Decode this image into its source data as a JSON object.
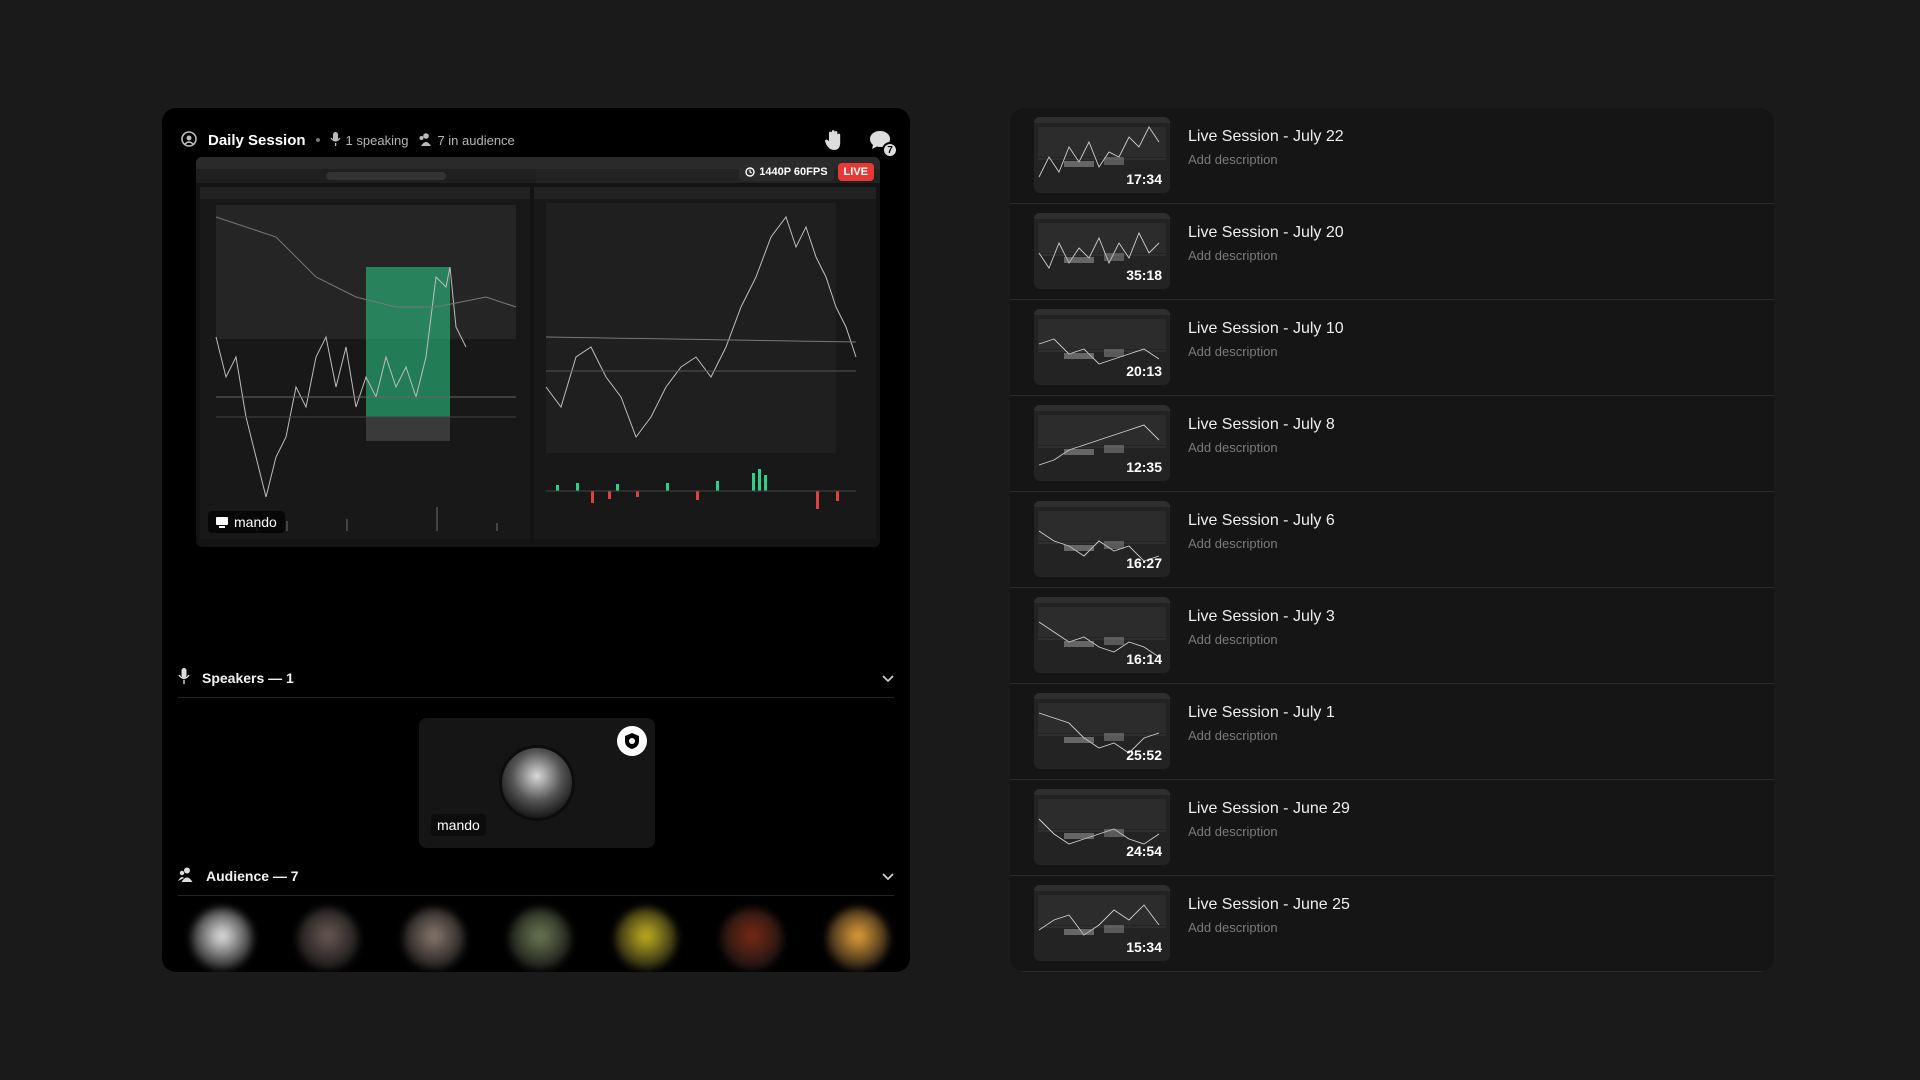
{
  "stage": {
    "title": "Daily Session",
    "speaking": "1 speaking",
    "audience_count": "7 in audience",
    "notification_count": "7",
    "stream": {
      "quality": "1440P 60FPS",
      "live": "LIVE",
      "user": "mando"
    },
    "speakers_label": "Speakers — 1",
    "speaker": {
      "name": "mando"
    },
    "audience_label": "Audience — 7",
    "audience": [
      {
        "color": "#e8e8e8"
      },
      {
        "color": "#6b5a55"
      },
      {
        "color": "#8a7a70"
      },
      {
        "color": "#6e7a55"
      },
      {
        "color": "#c6b420"
      },
      {
        "color": "#7a2a15"
      },
      {
        "color": "#e8a23a"
      }
    ],
    "colors": {
      "accent_red": "#e0383e",
      "live_red": "#e53935",
      "screen_green": "#2bd08a"
    }
  },
  "sessions": [
    {
      "title": "Live Session - July 22",
      "description": "Add description",
      "duration": "17:34"
    },
    {
      "title": "Live Session - July 20",
      "description": "Add description",
      "duration": "35:18"
    },
    {
      "title": "Live Session - July 10",
      "description": "Add description",
      "duration": "20:13"
    },
    {
      "title": "Live Session - July 8",
      "description": "Add description",
      "duration": "12:35"
    },
    {
      "title": "Live Session - July 6",
      "description": "Add description",
      "duration": "16:27"
    },
    {
      "title": "Live Session - July 3",
      "description": "Add description",
      "duration": "16:14"
    },
    {
      "title": "Live Session - July 1",
      "description": "Add description",
      "duration": "25:52"
    },
    {
      "title": "Live Session - June 29",
      "description": "Add description",
      "duration": "24:54"
    },
    {
      "title": "Live Session - June 25",
      "description": "Add description",
      "duration": "15:34"
    }
  ]
}
